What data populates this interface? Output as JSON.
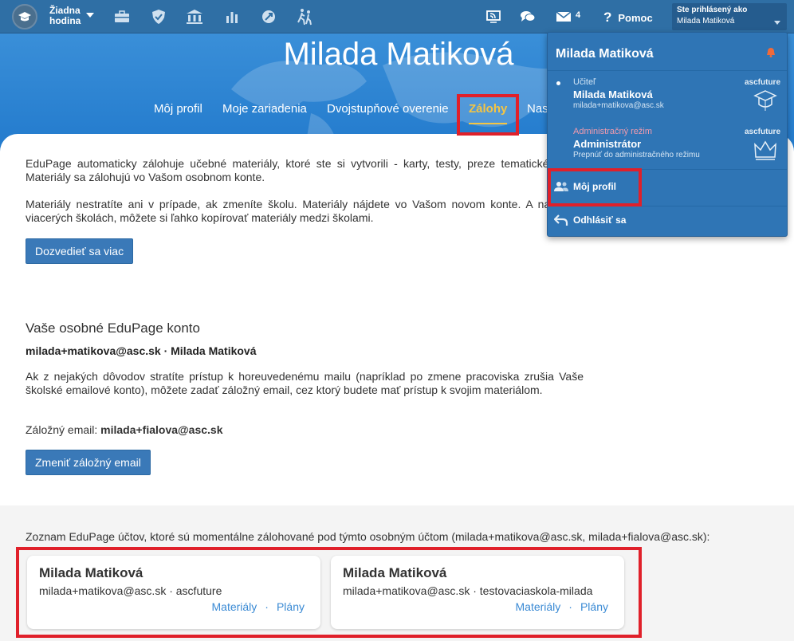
{
  "topbar": {
    "hodina": [
      "Žiadna",
      "hodina"
    ],
    "mail_count": "4",
    "help_label": "Pomoc",
    "user_label": "Ste prihlásený ako",
    "user_name": "Milada Matiková",
    "icons": [
      "briefcase-icon",
      "shield-icon",
      "bank-icon",
      "chart-icon",
      "rocket-icon",
      "running-icon",
      "cast-icon",
      "chat-icon",
      "mail-icon",
      "help-icon"
    ]
  },
  "hero": {
    "title": "Milada Matiková",
    "tabs": [
      {
        "label": "Môj profil",
        "active": false
      },
      {
        "label": "Moje zariadenia",
        "active": false
      },
      {
        "label": "Dvojstupňové overenie",
        "active": false
      },
      {
        "label": "Zálohy",
        "active": true
      },
      {
        "label": "Nas",
        "active": false
      }
    ]
  },
  "content": {
    "p1": "EduPage automaticky zálohuje učebné materiály, ktoré ste si vytvorili - karty, testy, preze tematické plány. Materiály sa zálohujú vo Vašom osobnom konte.",
    "p2": "Materiály nestratíte ani v prípade, ak zmeníte školu. Materiály nájdete vo Vašom novom konte. A naraz na viacerých školách, môžete si ľahko kopírovať materiály medzi školami.",
    "learn_more_button": "Dozvedieť sa viac",
    "section_title": "Vaše osobné EduPage konto",
    "account_line": "milada+matikova@asc.sk · Milada Matiková",
    "p3": "Ak z nejakých dôvodov stratíte prístup k horeuvedenému mailu (napríklad po zmene pracoviska zrušia Vaše školské emailové konto), môžete zadať záložný email, cez ktorý budete mať prístup k svojim materiálom.",
    "backup_label": "Záložný email:",
    "backup_email": "milada+fialova@asc.sk",
    "change_button": "Zmeniť záložný email"
  },
  "accounts": {
    "title": "Zoznam EduPage účtov, ktoré sú momentálne zálohované pod týmto osobným účtom (milada+matikova@asc.sk, milada+fialova@asc.sk):",
    "items": [
      {
        "name": "Milada Matiková",
        "sub": "milada+matikova@asc.sk · ascfuture",
        "link1": "Materiály",
        "sep": "·",
        "link2": "Plány"
      },
      {
        "name": "Milada Matiková",
        "sub": "milada+matikova@asc.sk · testovaciaskola-milada",
        "link1": "Materiály",
        "sep": "·",
        "link2": "Plány"
      }
    ]
  },
  "dropdown": {
    "header": "Milada Matiková",
    "role1": {
      "role": "Učiteľ",
      "name": "Milada Matiková",
      "sub": "milada+matikova@asc.sk",
      "school": "ascfuture"
    },
    "role2": {
      "role": "Administračný režim",
      "name": "Administrátor",
      "sub": "Prepnúť do administračného režimu",
      "school": "ascfuture"
    },
    "my_profile": "Môj profil",
    "logout": "Odhlásiť sa"
  },
  "colors": {
    "topbar": "#2f6fa5",
    "hero": "#1a73c9",
    "accent": "#f5c542",
    "highlight": "#e0202a",
    "link": "#3a8ad4"
  }
}
